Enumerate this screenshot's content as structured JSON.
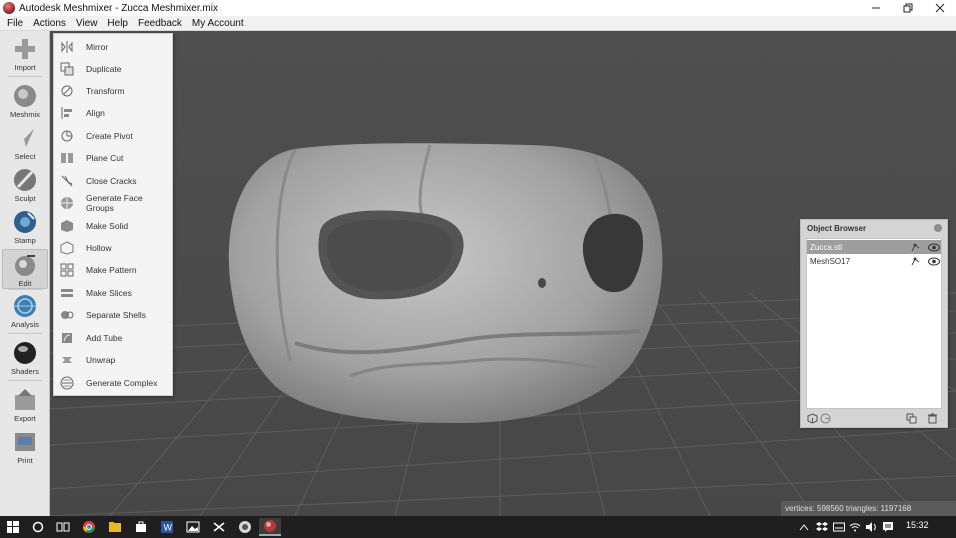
{
  "window": {
    "title": "Autodesk Meshmixer - Zucca Meshmixer.mix",
    "controls": [
      "minimize-icon",
      "restore-icon",
      "close-icon"
    ]
  },
  "menubar": {
    "items": [
      "File",
      "Actions",
      "View",
      "Help",
      "Feedback",
      "My Account"
    ]
  },
  "toolbar": {
    "tools": [
      {
        "label": "Import",
        "icon": "import-icon"
      },
      {
        "label": "Meshmix",
        "icon": "meshmix-icon"
      },
      {
        "label": "Select",
        "icon": "select-icon"
      },
      {
        "label": "Sculpt",
        "icon": "sculpt-icon"
      },
      {
        "label": "Stamp",
        "icon": "stamp-icon"
      },
      {
        "label": "Edit",
        "icon": "edit-icon",
        "active": true
      },
      {
        "label": "Analysis",
        "icon": "analysis-icon"
      },
      {
        "label": "Shaders",
        "icon": "shaders-icon"
      },
      {
        "label": "Export",
        "icon": "export-icon"
      },
      {
        "label": "Print",
        "icon": "print-icon"
      }
    ]
  },
  "edit_menu": {
    "items": [
      {
        "label": "Mirror",
        "icon": "mirror-icon"
      },
      {
        "label": "Duplicate",
        "icon": "duplicate-icon"
      },
      {
        "label": "Transform",
        "icon": "transform-icon"
      },
      {
        "label": "Align",
        "icon": "align-icon"
      },
      {
        "label": "Create Pivot",
        "icon": "pivot-icon"
      },
      {
        "label": "Plane Cut",
        "icon": "plane-cut-icon"
      },
      {
        "label": "Close Cracks",
        "icon": "close-cracks-icon"
      },
      {
        "label": "Generate Face Groups",
        "icon": "face-groups-icon"
      },
      {
        "label": "Make Solid",
        "icon": "make-solid-icon"
      },
      {
        "label": "Hollow",
        "icon": "hollow-icon"
      },
      {
        "label": "Make Pattern",
        "icon": "make-pattern-icon"
      },
      {
        "label": "Make Slices",
        "icon": "make-slices-icon"
      },
      {
        "label": "Separate Shells",
        "icon": "separate-shells-icon"
      },
      {
        "label": "Add Tube",
        "icon": "add-tube-icon"
      },
      {
        "label": "Unwrap",
        "icon": "unwrap-icon"
      },
      {
        "label": "Generate Complex",
        "icon": "generate-complex-icon"
      }
    ]
  },
  "object_browser": {
    "title": "Object Browser",
    "objects": [
      {
        "name": "Zucca.stl",
        "selected": true
      },
      {
        "name": "MeshSO17",
        "selected": false
      }
    ]
  },
  "status": {
    "text": "vertices: 598560 triangles: 1197168"
  },
  "taskbar": {
    "clock": "15:32",
    "apps": [
      "start-icon",
      "search-icon",
      "task-view-icon",
      "chrome-icon",
      "file-explorer-icon",
      "store-icon",
      "word-icon",
      "photos-icon",
      "snipping-tool-icon",
      "app-icon",
      "meshmixer-icon"
    ]
  },
  "colors": {
    "viewport_bg": "#4a4a4a",
    "grid": "#5c5c5c",
    "model": "#a6a6a6",
    "toolbar_bg": "#e7e7e7",
    "menu_bg": "#f4f4f4",
    "selected_row": "#9e9e9e"
  }
}
